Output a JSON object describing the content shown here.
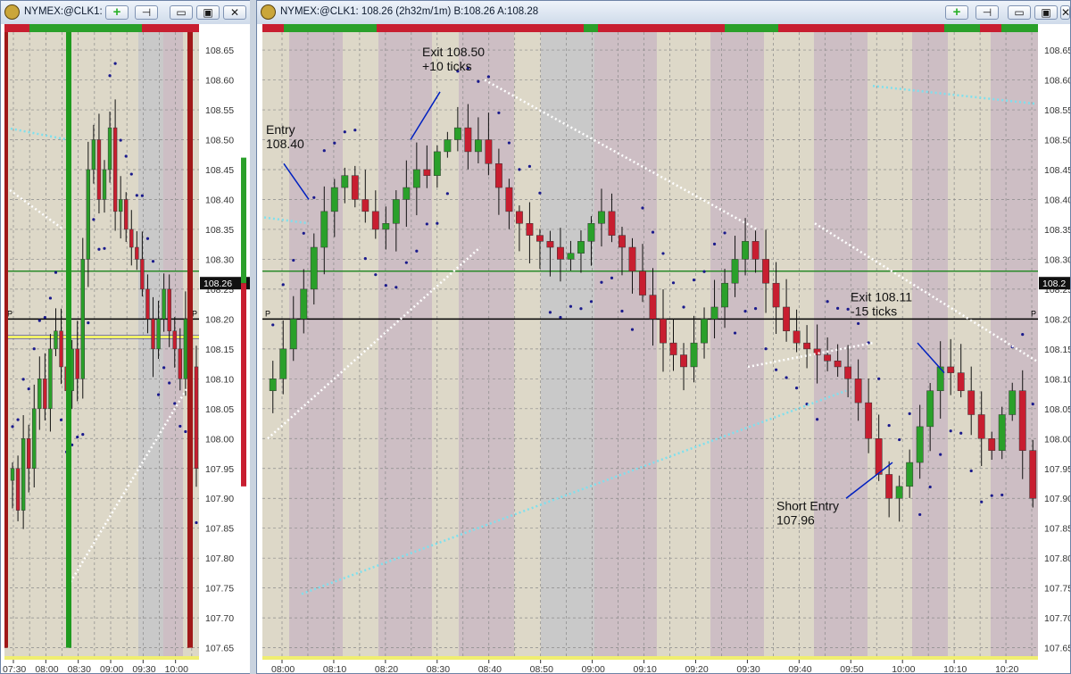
{
  "windows": {
    "left": {
      "title": "NYMEX:@CLK1:",
      "price_tag": "108.26",
      "time_labels": [
        "07:30",
        "08:00",
        "08:30",
        "09:00",
        "09:30",
        "10:00"
      ]
    },
    "right": {
      "title": "NYMEX:@CLK1: 108.26 (2h32m/1m)  B:108.26  A:108.28",
      "price_tag": "108.2",
      "time_labels": [
        "08:00",
        "08:10",
        "08:20",
        "08:30",
        "08:40",
        "08:50",
        "09:00",
        "09:10",
        "09:20",
        "09:30",
        "09:40",
        "09:50",
        "10:00",
        "10:10",
        "10:20"
      ]
    }
  },
  "icons": {
    "logo": "cog-logo-icon",
    "add": "plus-icon",
    "pin": "pin-icon",
    "min": "minimize-icon",
    "max": "maximize-icon",
    "close": "close-icon"
  },
  "colors": {
    "up": "#2aa02a",
    "down": "#c81e30",
    "green_line": "#2a8a2a",
    "black_line": "#000000",
    "cyan": "#7ee0ee",
    "white_dots": "#ffffff",
    "blue_dots": "#1a1a8c",
    "yellow": "#f0f06a",
    "annotation": "#0020c0",
    "bg_tan": "#ddd8c8",
    "bg_gray": "#c9c9c9",
    "bg_pink": "#cdbec4"
  },
  "chart_data": [
    {
      "type": "candlestick",
      "ylim": [
        107.63,
        108.68
      ],
      "y_ticks": [
        "108.65",
        "108.60",
        "108.55",
        "108.50",
        "108.45",
        "108.40",
        "108.35",
        "108.30",
        "108.25",
        "108.20",
        "108.15",
        "108.10",
        "108.05",
        "108.00",
        "107.95",
        "107.90",
        "107.85",
        "107.80",
        "107.75",
        "107.70",
        "107.65"
      ],
      "horizontal_lines": [
        {
          "value": 108.28,
          "color": "green"
        },
        {
          "value": 108.2,
          "color": "black",
          "label": "P"
        },
        {
          "value": 108.17,
          "color": "navy"
        },
        {
          "value": 108.17,
          "color": "yellow"
        }
      ],
      "close_series": [
        107.95,
        107.88,
        108.0,
        107.95,
        108.05,
        108.1,
        108.05,
        108.15,
        108.18,
        108.12,
        108.08,
        108.15,
        108.1,
        108.3,
        108.45,
        108.5,
        108.4,
        108.45,
        108.52,
        108.38,
        108.4,
        108.35,
        108.32,
        108.3,
        108.25,
        108.2,
        108.15,
        108.2,
        108.25,
        108.18,
        108.15,
        108.1,
        108.2,
        108.12,
        107.95
      ]
    },
    {
      "type": "candlestick",
      "ylim": [
        107.63,
        108.68
      ],
      "y_ticks": [
        "108.65",
        "108.60",
        "108.55",
        "108.50",
        "108.45",
        "108.40",
        "108.35",
        "108.30",
        "108.25",
        "108.20",
        "108.15",
        "108.10",
        "108.05",
        "108.00",
        "107.95",
        "107.90",
        "107.85",
        "107.80",
        "107.75",
        "107.70",
        "107.65"
      ],
      "horizontal_lines": [
        {
          "value": 108.28,
          "color": "green"
        },
        {
          "value": 108.2,
          "color": "black",
          "label": "P"
        }
      ],
      "close_series": [
        108.1,
        108.15,
        108.2,
        108.25,
        108.32,
        108.38,
        108.42,
        108.44,
        108.4,
        108.38,
        108.35,
        108.36,
        108.4,
        108.42,
        108.45,
        108.44,
        108.48,
        108.5,
        108.52,
        108.48,
        108.5,
        108.46,
        108.42,
        108.38,
        108.36,
        108.34,
        108.33,
        108.32,
        108.3,
        108.31,
        108.33,
        108.36,
        108.38,
        108.34,
        108.32,
        108.28,
        108.24,
        108.2,
        108.16,
        108.14,
        108.12,
        108.16,
        108.2,
        108.22,
        108.26,
        108.3,
        108.33,
        108.3,
        108.26,
        108.22,
        108.18,
        108.16,
        108.15,
        108.14,
        108.13,
        108.12,
        108.1,
        108.06,
        108.0,
        107.94,
        107.9,
        107.92,
        107.96,
        108.02,
        108.08,
        108.12,
        108.11,
        108.08,
        108.04,
        108.0,
        107.98,
        108.04,
        108.08,
        107.98,
        107.9
      ],
      "annotations": [
        {
          "lines": [
            "Exit 108.50",
            "+10 ticks"
          ]
        },
        {
          "lines": [
            "Entry",
            "108.40"
          ]
        },
        {
          "lines": [
            "Exit 108.11",
            "-15 ticks"
          ]
        },
        {
          "lines": [
            "Short Entry",
            "107.96"
          ]
        }
      ]
    }
  ]
}
